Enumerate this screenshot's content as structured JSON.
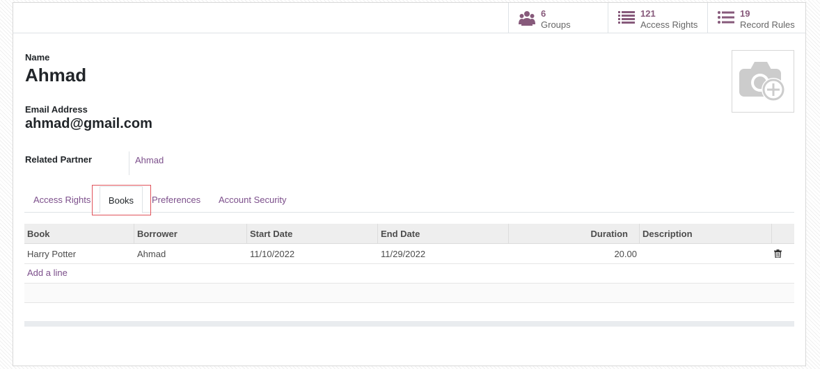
{
  "stat_buttons": [
    {
      "value": "6",
      "label": "Groups",
      "icon": "users-icon"
    },
    {
      "value": "121",
      "label": "Access Rights",
      "icon": "list-icon"
    },
    {
      "value": "19",
      "label": "Record Rules",
      "icon": "list-icon"
    }
  ],
  "form": {
    "name_label": "Name",
    "name_value": "Ahmad",
    "email_label": "Email Address",
    "email_value": "ahmad@gmail.com",
    "partner_label": "Related Partner",
    "partner_value": "Ahmad",
    "avatar_icon": "camera-plus-icon"
  },
  "tabs": [
    {
      "label": "Access Rights",
      "active": false
    },
    {
      "label": "Books",
      "active": true
    },
    {
      "label": "Preferences",
      "active": false
    },
    {
      "label": "Account Security",
      "active": false
    }
  ],
  "table": {
    "columns": [
      "Book",
      "Borrower",
      "Start Date",
      "End Date",
      "Duration",
      "Description"
    ],
    "rows": [
      {
        "book": "Harry Potter",
        "borrower": "Ahmad",
        "start_date": "11/10/2022",
        "end_date": "11/29/2022",
        "duration": "20.00",
        "description": ""
      }
    ],
    "add_line": "Add a line",
    "row_action_icon": "trash-icon"
  },
  "colors": {
    "accent": "#875a7b",
    "link": "#7c4f8b",
    "focus_outline": "#e0525a"
  }
}
